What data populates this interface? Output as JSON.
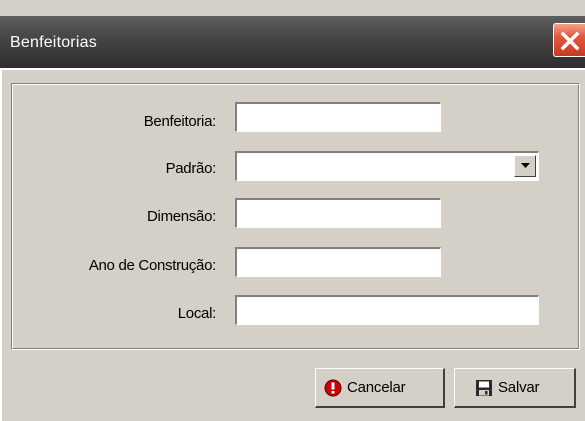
{
  "window": {
    "title": "Benfeitorias",
    "close_icon": "close-x-icon",
    "close_color": "#d9452b",
    "titlebar_color": "#454344"
  },
  "form": {
    "benfeitoria": {
      "label": "Benfeitoria:",
      "value": ""
    },
    "padrao": {
      "label": "Padrão:",
      "value": "",
      "icon": "dropdown-arrow-icon"
    },
    "dimensao": {
      "label": "Dimensão:",
      "value": ""
    },
    "ano_construcao": {
      "label": "Ano de Construção:",
      "value": ""
    },
    "local": {
      "label": "Local:",
      "value": ""
    }
  },
  "buttons": {
    "cancel": {
      "label": "Cancelar",
      "icon": "cancel-stop-icon",
      "icon_color": "#cc0000"
    },
    "save": {
      "label": "Salvar",
      "icon": "floppy-disk-icon"
    }
  }
}
